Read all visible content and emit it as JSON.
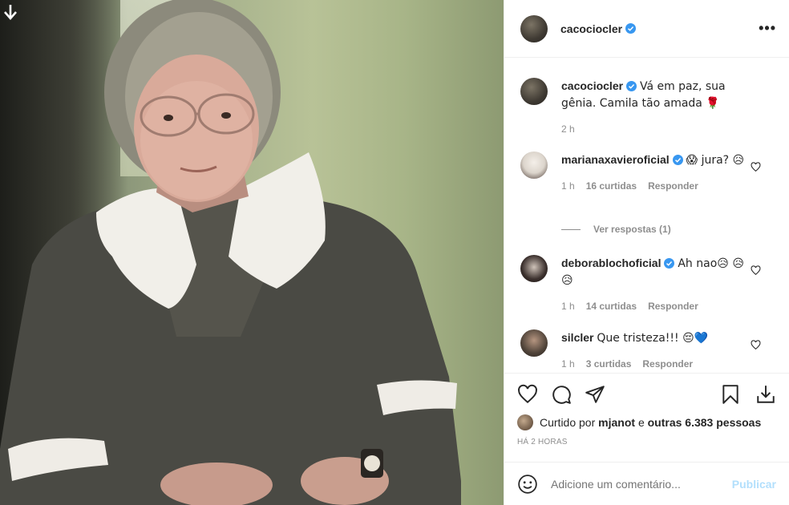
{
  "post": {
    "author": "cacociocler",
    "more_icon": "more-horizontal-icon",
    "caption": {
      "username": "cacociocler",
      "text": "Vá em paz, sua gênia. Camila tão amada 🌹",
      "time": "2 h"
    }
  },
  "comments": [
    {
      "username": "marianaxavieroficial",
      "text": "😱 jura? 😥",
      "time": "1 h",
      "likes": "16 curtidas",
      "reply": "Responder",
      "view_replies": "Ver respostas (1)"
    },
    {
      "username": "deborablochoficial",
      "text": "Ah nao😥 😥😥",
      "time": "1 h",
      "likes": "14 curtidas",
      "reply": "Responder"
    },
    {
      "username": "silcler",
      "text": "Que tristeza!!! 😔💙",
      "time": "1 h",
      "likes": "3 curtidas",
      "reply": "Responder"
    }
  ],
  "actions": {
    "icons": [
      "heart-icon",
      "comment-icon",
      "share-icon",
      "bookmark-icon",
      "download-icon"
    ],
    "liked_by_prefix": "Curtido por",
    "liked_by_user": "mjanot",
    "liked_by_joiner": "e",
    "liked_by_others": "outras 6.383 pessoas",
    "timestamp": "HÁ 2 HORAS"
  },
  "composer": {
    "placeholder": "Adicione um comentário...",
    "post_label": "Publicar"
  },
  "colors": {
    "verified": "#3897f0",
    "link_disabled": "#b2dffc",
    "muted": "#8e8e8e"
  }
}
